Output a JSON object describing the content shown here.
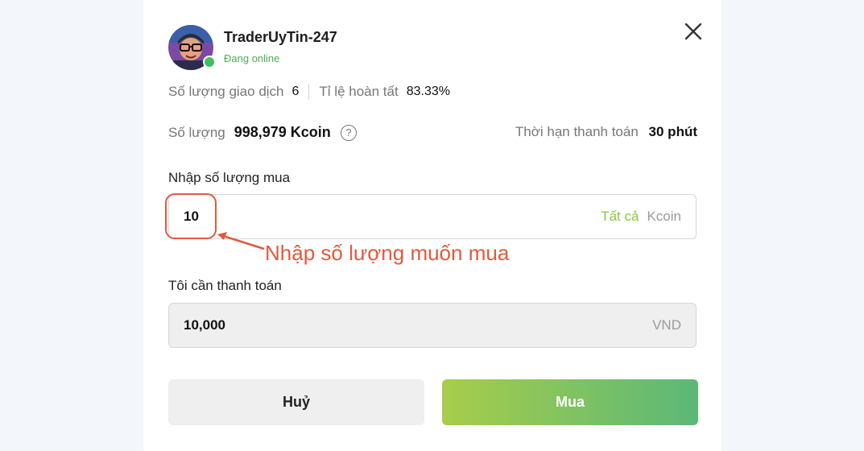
{
  "trader": {
    "name": "TraderUyTin-247",
    "status": "Đang online"
  },
  "stats": {
    "trades_label": "Số lượng giao dịch",
    "trades_value": "6",
    "completion_label": "Tỉ lệ hoàn tất",
    "completion_value": "83.33%"
  },
  "offer": {
    "amount_label": "Số lượng",
    "amount_value": "998,979 Kcoin",
    "payment_limit_label": "Thời hạn thanh toán",
    "payment_limit_value": "30 phút"
  },
  "buy_input": {
    "label": "Nhập số lượng mua",
    "value": "10",
    "all_link": "Tất cả",
    "unit": "Kcoin"
  },
  "annotation": {
    "text": "Nhập số lượng muốn mua"
  },
  "pay_input": {
    "label": "Tôi cần thanh toán",
    "value": "10,000",
    "unit": "VND"
  },
  "buttons": {
    "cancel": "Huỷ",
    "buy": "Mua"
  },
  "colors": {
    "accent_green": "#8cc63f",
    "online_green": "#4caf50",
    "annotation_red": "#e05a3e"
  },
  "icons": [
    "close-icon",
    "help-icon",
    "avatar"
  ]
}
